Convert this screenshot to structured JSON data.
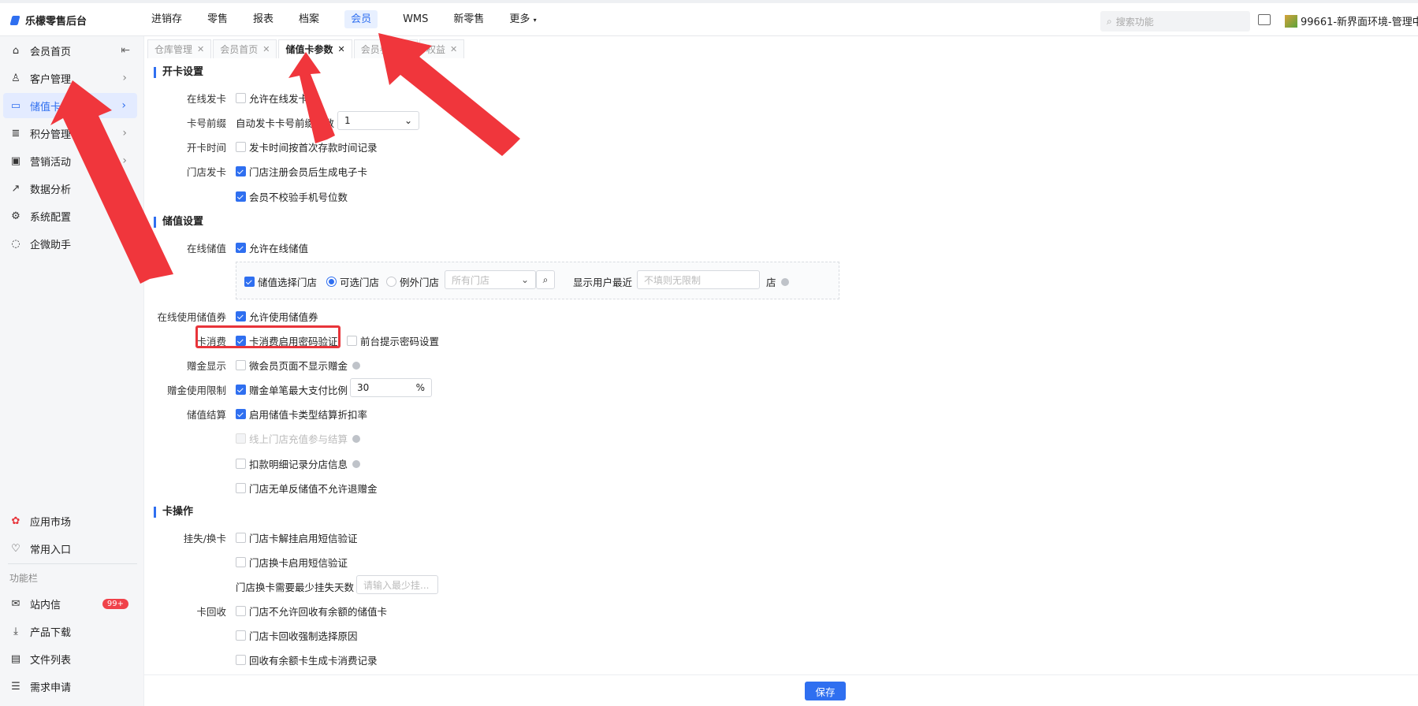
{
  "app": {
    "title": "乐檬零售后台"
  },
  "topnav": [
    "进销存",
    "零售",
    "报表",
    "档案",
    "会员",
    "WMS",
    "新零售",
    "更多"
  ],
  "topnav_active": "会员",
  "search": {
    "placeholder": "搜索功能"
  },
  "store": {
    "name": "99661-新界面环境-管理中心"
  },
  "sidebar": {
    "items": [
      {
        "label": "会员首页",
        "icon": "home-icon"
      },
      {
        "label": "客户管理",
        "icon": "user-icon"
      },
      {
        "label": "储值卡",
        "icon": "card-icon"
      },
      {
        "label": "积分管理",
        "icon": "database-icon"
      },
      {
        "label": "营销活动",
        "icon": "monitor-icon"
      },
      {
        "label": "数据分析",
        "icon": "chart-line-icon"
      },
      {
        "label": "系统配置",
        "icon": "settings-icon"
      },
      {
        "label": "企微助手",
        "icon": "chat-icon"
      }
    ],
    "bottom": [
      {
        "label": "应用市场"
      },
      {
        "label": "常用入口"
      }
    ],
    "group_title": "功能栏",
    "func": [
      {
        "label": "站内信",
        "badge": "99+"
      },
      {
        "label": "产品下载"
      },
      {
        "label": "文件列表"
      },
      {
        "label": "需求申请"
      }
    ]
  },
  "tabs": [
    {
      "label": "仓库管理"
    },
    {
      "label": "会员首页"
    },
    {
      "label": "储值卡参数"
    },
    {
      "label": "会员参数"
    },
    {
      "label": "权益"
    }
  ],
  "sections": {
    "open_card": "开卡设置",
    "stored_value": "储值设置",
    "card_ops": "卡操作"
  },
  "form": {
    "online_issue_label": "在线发卡",
    "online_issue_cb": "允许在线发卡",
    "card_prefix_label": "卡号前缀",
    "card_prefix_text": "自动发卡卡号前缀位数",
    "card_prefix_value": "1",
    "open_time_label": "开卡时间",
    "open_time_cb": "发卡时间按首次存款时间记录",
    "store_issue_label": "门店发卡",
    "store_issue_cb1": "门店注册会员后生成电子卡",
    "store_issue_cb2": "会员不校验手机号位数",
    "online_recharge_label": "在线储值",
    "online_recharge_cb": "允许在线储值",
    "recharge_store_cb": "储值选择门店",
    "radio_optional": "可选门店",
    "radio_except": "例外门店",
    "all_stores_placeholder": "所有门店",
    "show_recent_label": "显示用户最近",
    "no_limit_placeholder": "不填则无限制",
    "store_suffix": "店",
    "online_coupon_label": "在线使用储值券",
    "online_coupon_cb": "允许使用储值券",
    "card_consume_label": "卡消费",
    "card_consume_cb": "卡消费启用密码验证",
    "front_pwd_cb": "前台提示密码设置",
    "gift_display_label": "赠金显示",
    "gift_display_cb": "微会员页面不显示赠金",
    "gift_limit_label": "赠金使用限制",
    "gift_limit_cb": "赠金单笔最大支付比例",
    "gift_limit_value": "30",
    "gift_limit_unit": "%",
    "settle_label": "储值结算",
    "settle_cb1": "启用储值卡类型结算折扣率",
    "settle_cb2": "线上门店充值参与结算",
    "settle_cb3": "扣款明细记录分店信息",
    "settle_cb4": "门店无单反储值不允许退赠金",
    "loss_label": "挂失/换卡",
    "loss_cb1": "门店卡解挂启用短信验证",
    "loss_cb2": "门店换卡启用短信验证",
    "loss_days_text": "门店换卡需要最少挂失天数",
    "loss_days_placeholder": "请输入最少挂...",
    "recycle_label": "卡回收",
    "recycle_cb1": "门店不允许回收有余额的储值卡",
    "recycle_cb2": "门店卡回收强制选择原因",
    "recycle_cb3": "回收有余额卡生成卡消费记录"
  },
  "footer": {
    "save": "保存"
  },
  "colors": {
    "accent": "#2f6ff0",
    "annotation": "#e8343a"
  }
}
